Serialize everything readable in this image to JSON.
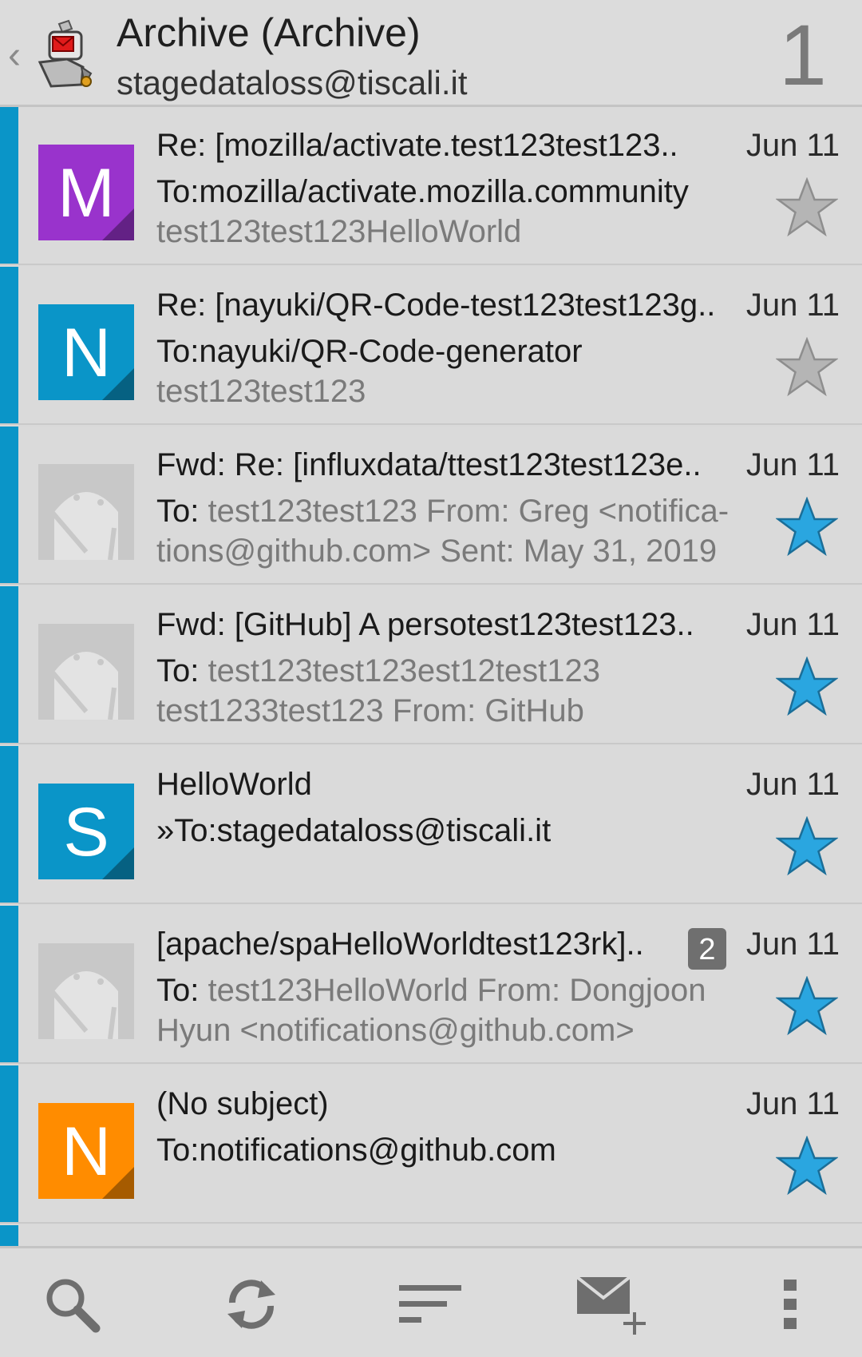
{
  "header": {
    "title": "Archive (Archive)",
    "subtitle": "stagedataloss@tiscali.it",
    "count": "1"
  },
  "colors": {
    "accent": "#0a95c8",
    "star_active": "#2aa6e0",
    "star_inactive": "#b5b5b5"
  },
  "messages": [
    {
      "subject": "Re: [mozilla/activate.test123test123..",
      "date": "Jun 11",
      "to_label": "To:mozilla/activate.mozilla.community",
      "to_rest": "",
      "preview": "test123test123HelloWorld",
      "avatar_letter": "M",
      "avatar_color": "#9933cc",
      "starred": false
    },
    {
      "subject": "Re: [nayuki/QR-Code-test123test123g..",
      "date": "Jun 11",
      "to_label": "To:nayuki/QR-Code-generator",
      "to_rest": "",
      "preview": "test123test123",
      "avatar_letter": "N",
      "avatar_color": "#0a95c8",
      "starred": false
    },
    {
      "subject": "Fwd: Re: [influxdata/ttest123test123e..",
      "date": "Jun 11",
      "to_label": "To: ",
      "to_rest": "test123test123 From: Greg <notifica-",
      "preview": "tions@github.com> Sent: May 31, 2019",
      "avatar_letter": "",
      "avatar_color": "",
      "starred": true
    },
    {
      "subject": "Fwd: [GitHub] A persotest123test123..",
      "date": "Jun 11",
      "to_label": "To: ",
      "to_rest": "test123test123est12test123",
      "preview": "test1233test123 From: GitHub",
      "avatar_letter": "",
      "avatar_color": "",
      "starred": true
    },
    {
      "subject": "HelloWorld",
      "date": "Jun 11",
      "to_label": "»To:stagedataloss@tiscali.it",
      "to_rest": "",
      "preview": "",
      "avatar_letter": "S",
      "avatar_color": "#0a95c8",
      "starred": true
    },
    {
      "subject": "[apache/spaHelloWorldtest123rk]..",
      "date": "Jun 11",
      "badge": "2",
      "to_label": "To: ",
      "to_rest": "test123HelloWorld From: Dongjoon",
      "preview": "Hyun <notifications@github.com>",
      "avatar_letter": "",
      "avatar_color": "",
      "starred": true
    },
    {
      "subject": "(No subject)",
      "date": "Jun 11",
      "to_label": "To:notifications@github.com",
      "to_rest": "",
      "preview": "",
      "avatar_letter": "N",
      "avatar_color": "#ff8c00",
      "starred": true
    }
  ],
  "toolbar": {
    "icons": [
      "search-icon",
      "refresh-icon",
      "sort-icon",
      "compose-icon",
      "overflow-menu-icon"
    ]
  }
}
